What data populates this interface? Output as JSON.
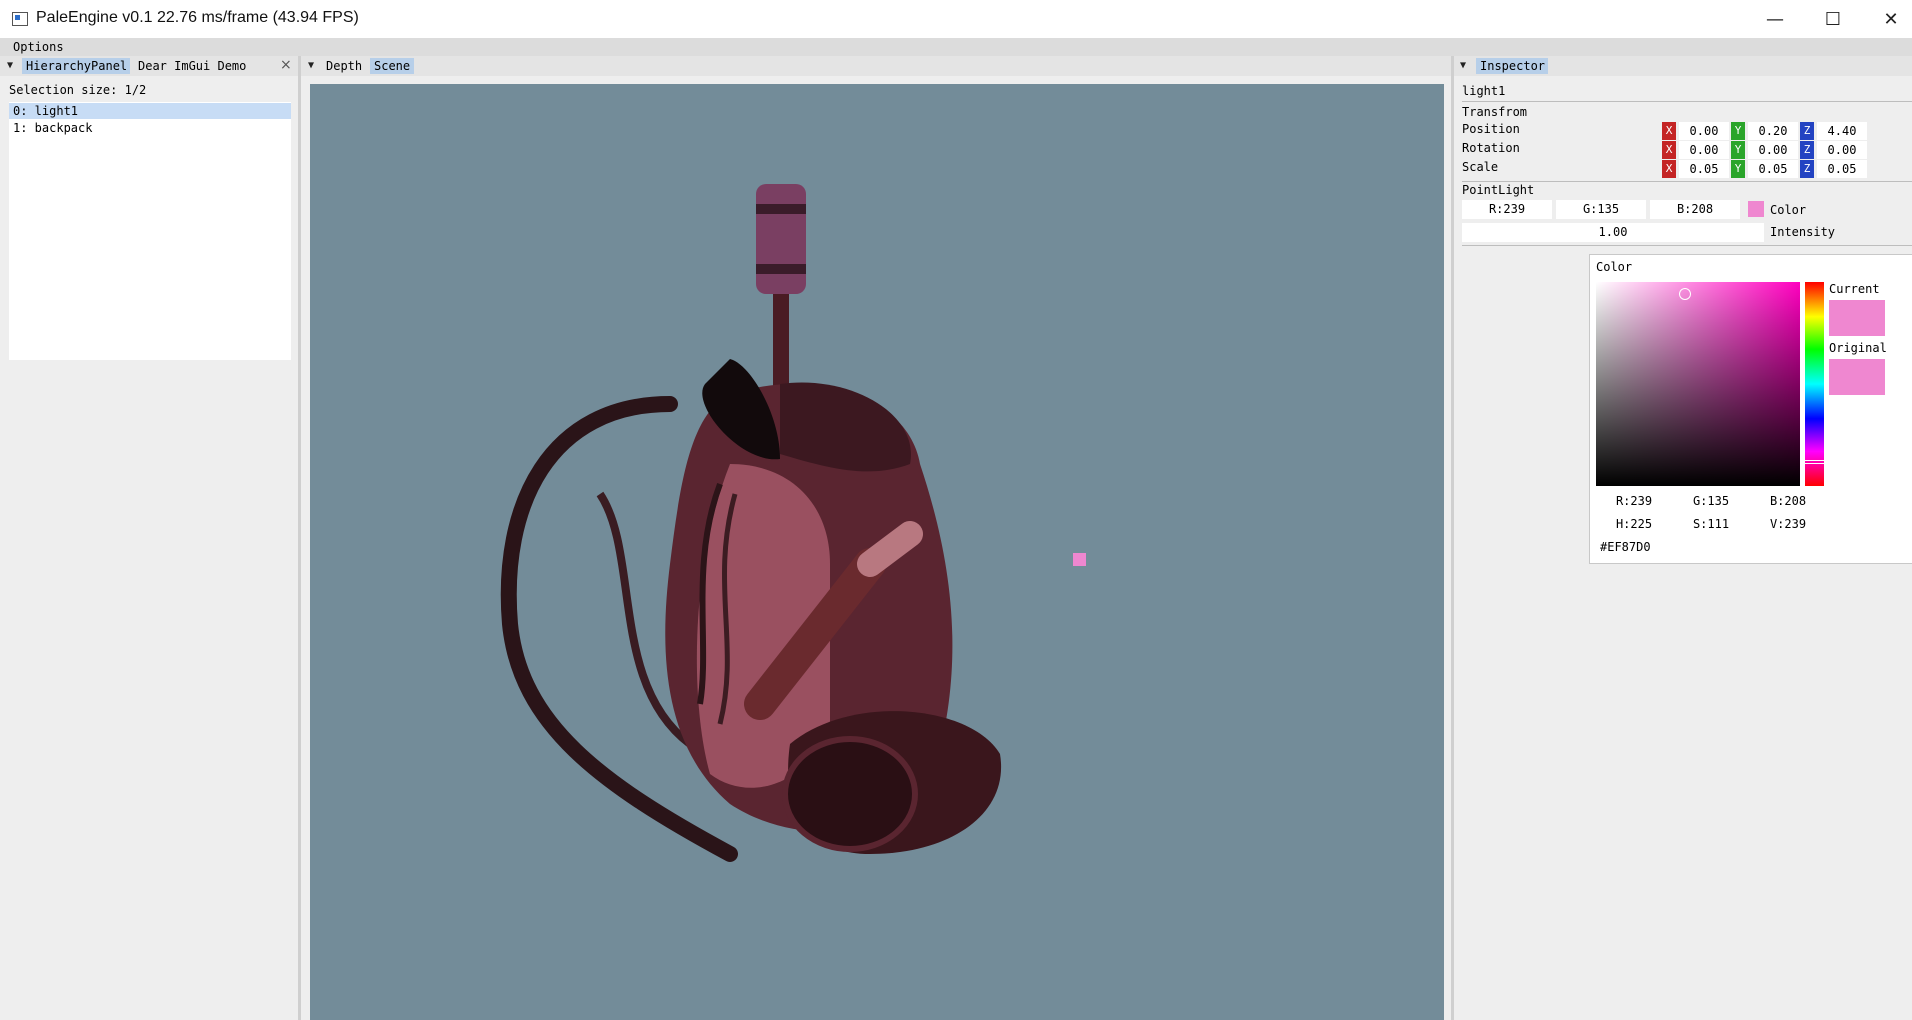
{
  "window": {
    "title": "PaleEngine v0.1 22.76 ms/frame (43.94 FPS)",
    "controls": [
      "—",
      "☐",
      "✕"
    ]
  },
  "menu": {
    "options": "Options"
  },
  "hierarchy": {
    "tabs": [
      "HierarchyPanel",
      "Dear ImGui Demo"
    ],
    "close": "×",
    "selection_size": "Selection size: 1/2",
    "items": [
      "0: light1",
      "1: backpack"
    ]
  },
  "viewport": {
    "tabs": [
      "Depth",
      "Scene"
    ]
  },
  "inspector": {
    "tab": "Inspector",
    "object_name": "light1",
    "transform": {
      "header": "Transfrom",
      "position_label": "Position",
      "rotation_label": "Rotation",
      "scale_label": "Scale",
      "axis_x": "X",
      "axis_y": "Y",
      "axis_z": "Z",
      "position": [
        "0.00",
        "0.20",
        "4.40"
      ],
      "rotation": [
        "0.00",
        "0.00",
        "0.00"
      ],
      "scale": [
        "0.05",
        "0.05",
        "0.05"
      ]
    },
    "pointlight": {
      "header": "PointLight",
      "r": "R:239",
      "g": "G:135",
      "b": "B:208",
      "color_label": "Color",
      "intensity": "1.00",
      "intensity_label": "Intensity",
      "color_hex": "#EF87D0"
    },
    "picker": {
      "title": "Color",
      "current_label": "Current",
      "original_label": "Original",
      "r": "R:239",
      "g": "G:135",
      "b": "B:208",
      "h": "H:225",
      "s": "S:111",
      "v": "V:239",
      "hex": "#EF87D0"
    }
  },
  "colors": {
    "scene_bg": "#738c99",
    "tab_active": "#b7cfe9",
    "selection": "#c7dcf5",
    "light_color": "#ef87d0"
  },
  "icons": [
    "app-window-icon",
    "minimize-icon",
    "maximize-icon",
    "close-icon",
    "dropdown-triangle-icon",
    "light-gizmo-icon",
    "backpack-3d-model"
  ]
}
